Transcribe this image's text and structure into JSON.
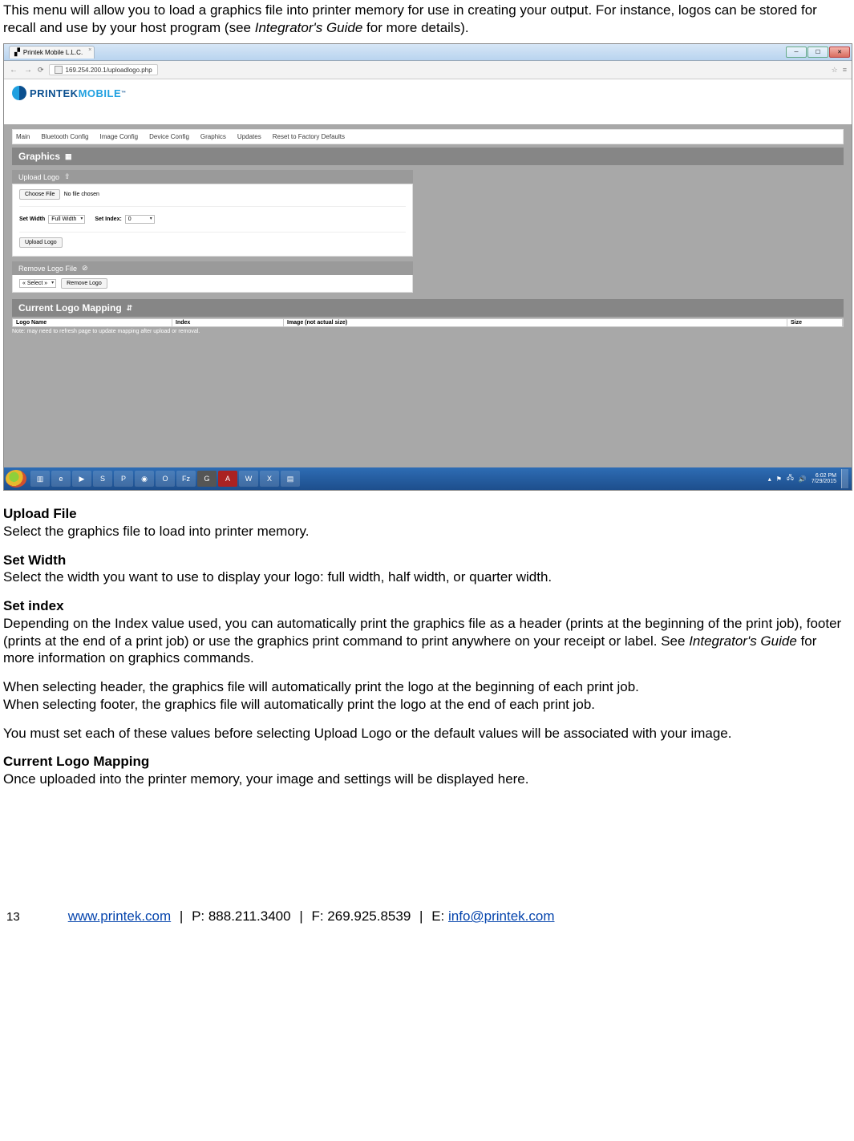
{
  "intro": {
    "line1": "This menu will allow you to load a graphics file into printer memory for use in creating your output.  For instance, logos can be stored for recall and use by your host program (see ",
    "em": "Integrator's Guide",
    "line1_after": " for more details)."
  },
  "screenshot": {
    "tab_title": "Printek Mobile L.L.C.",
    "url": "169.254.200.1/uploadlogo.php",
    "logo1": "PRINTEK",
    "logo2": "MOBILE",
    "nav": [
      "Main",
      "Bluetooth Config",
      "Image Config",
      "Device Config",
      "Graphics",
      "Updates",
      "Reset to Factory Defaults"
    ],
    "graphics_heading": "Graphics",
    "upload_heading": "Upload Logo",
    "choose_file_btn": "Choose File",
    "no_file": "No file chosen",
    "set_width_label": "Set Width",
    "set_width_value": "Full Width",
    "set_index_label": "Set Index:",
    "set_index_value": "0",
    "upload_btn": "Upload Logo",
    "remove_heading": "Remove Logo File",
    "remove_select": "« Select »",
    "remove_btn": "Remove Logo",
    "mapping_heading": "Current Logo Mapping",
    "th_name": "Logo Name",
    "th_index": "Index",
    "th_image": "Image (not actual size)",
    "th_size": "Size",
    "note": "Note: may need to refresh page to update mapping after upload or removal.",
    "clock_time": "6:02 PM",
    "clock_date": "7/29/2015"
  },
  "sections": {
    "upload_file_h": "Upload File",
    "upload_file_p": "Select the graphics file to load into printer memory.",
    "set_width_h": "Set Width",
    "set_width_p": "Select the width you want to use to display your logo: full width, half width, or quarter width.",
    "set_index_h": "Set index",
    "set_index_p1a": "Depending on the Index value used, you can automatically print the graphics file as a header (prints at the beginning of the print job), footer (prints at the end of a print job) or use the graphics print command to print anywhere on your receipt or label.  See ",
    "set_index_em": "Integrator's Guide",
    "set_index_p1b": " for more information on graphics commands.",
    "set_index_p2": "When selecting header, the graphics file will automatically print the logo at the beginning of each print job.\nWhen selecting footer, the graphics file will automatically print the logo at the end of each print job.",
    "set_index_p3": "You must set each of these values before selecting Upload Logo or the default values will be associated with your image.",
    "mapping_h": "Current Logo Mapping",
    "mapping_p": "Once uploaded into the printer memory, your image and settings will be displayed here."
  },
  "footer": {
    "page_no": "13",
    "url": "www.printek.com",
    "phone": "P: 888.211.3400",
    "fax": "F: 269.925.8539",
    "email_label": "E: ",
    "email": "info@printek.com"
  }
}
